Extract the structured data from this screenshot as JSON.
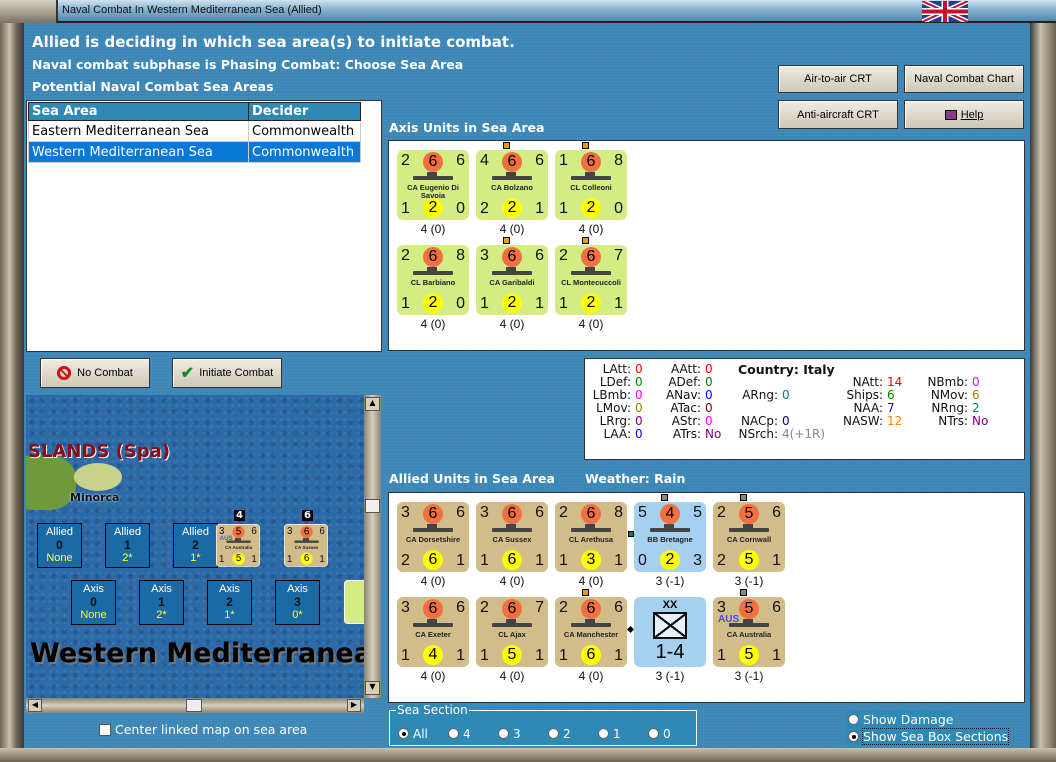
{
  "window": {
    "title": "Naval Combat In Western Mediterranean Sea (Allied)"
  },
  "header": {
    "line1": "Allied is deciding in which sea area(s) to initiate combat.",
    "line2": "Naval combat subphase is Phasing Combat: Choose Sea Area",
    "line3": "Potential Naval Combat Sea Areas"
  },
  "sea_table": {
    "columns": [
      "Sea Area",
      "Decider"
    ],
    "rows": [
      {
        "area": "Eastern Mediterranean Sea",
        "decider": "Commonwealth",
        "selected": false
      },
      {
        "area": "Western Mediterranean Sea",
        "decider": "Commonwealth",
        "selected": true
      }
    ]
  },
  "buttons": {
    "air_to_air": "Air-to-air CRT",
    "naval_chart": "Naval Combat Chart",
    "anti_aircraft": "Anti-aircraft CRT",
    "help": "Help",
    "no_combat": "No Combat",
    "initiate": "Initiate Combat"
  },
  "axis": {
    "title": "Axis Units in Sea Area",
    "units": [
      {
        "name": "CA Eugenio Di Savoia",
        "tl": "2",
        "tc": "6",
        "tr": "6",
        "bl": "1",
        "bc": "2",
        "br": "0",
        "label": "4 (0)",
        "marker": ""
      },
      {
        "name": "CA Bolzano",
        "tl": "4",
        "tc": "6",
        "tr": "6",
        "bl": "2",
        "bc": "2",
        "br": "1",
        "label": "4 (0)",
        "marker": "#e89a10"
      },
      {
        "name": "CL Colleoni",
        "tl": "1",
        "tc": "6",
        "tr": "8",
        "bl": "1",
        "bc": "2",
        "br": "0",
        "label": "4 (0)",
        "marker": "#e89a10"
      },
      {
        "name": "CL Barbiano",
        "tl": "2",
        "tc": "6",
        "tr": "8",
        "bl": "1",
        "bc": "2",
        "br": "0",
        "label": "4 (0)",
        "marker": ""
      },
      {
        "name": "CA Garibaldi",
        "tl": "3",
        "tc": "6",
        "tr": "6",
        "bl": "1",
        "bc": "2",
        "br": "1",
        "label": "4 (0)",
        "marker": "#e89a10"
      },
      {
        "name": "CL Montecuccoli",
        "tl": "2",
        "tc": "6",
        "tr": "7",
        "bl": "1",
        "bc": "2",
        "br": "1",
        "label": "4 (0)",
        "marker": "#e89a10"
      }
    ]
  },
  "stats": {
    "country_label": "Country: Italy",
    "items": [
      {
        "k": "LAtt:",
        "v": "0",
        "c": "#ff0000"
      },
      {
        "k": "LDef:",
        "v": "0",
        "c": "#008000"
      },
      {
        "k": "LBmb:",
        "v": "0",
        "c": "#ff00ff"
      },
      {
        "k": "LMov:",
        "v": "0",
        "c": "#a08000"
      },
      {
        "k": "LRrg:",
        "v": "0",
        "c": "#800080"
      },
      {
        "k": "LAA:",
        "v": "0",
        "c": "#0000ff"
      },
      {
        "k": "AAtt:",
        "v": "0",
        "c": "#ff0000"
      },
      {
        "k": "ADef:",
        "v": "0",
        "c": "#008000"
      },
      {
        "k": "ANav:",
        "v": "0",
        "c": "#0000ff"
      },
      {
        "k": "ATac:",
        "v": "0",
        "c": "#800000"
      },
      {
        "k": "AStr:",
        "v": "0",
        "c": "#ff00ff"
      },
      {
        "k": "ATrs:",
        "v": "No",
        "c": "#800080"
      },
      {
        "k": "ARng:",
        "v": "0",
        "c": "#008080"
      },
      {
        "k": "NACp:",
        "v": "0",
        "c": "#000080"
      },
      {
        "k": "NSrch:",
        "v": "4(+1R)",
        "c": "#888888"
      },
      {
        "k": "NAtt:",
        "v": "14",
        "c": "#ff0000"
      },
      {
        "k": "Ships:",
        "v": "6",
        "c": "#008000"
      },
      {
        "k": "NAA:",
        "v": "7",
        "c": "#0000ff"
      },
      {
        "k": "NASW:",
        "v": "12",
        "c": "#ff8000"
      },
      {
        "k": "NBmb:",
        "v": "0",
        "c": "#ff00ff"
      },
      {
        "k": "NMov:",
        "v": "6",
        "c": "#a08000"
      },
      {
        "k": "NRng:",
        "v": "2",
        "c": "#008080"
      },
      {
        "k": "NTrs:",
        "v": "No",
        "c": "#800080"
      }
    ]
  },
  "allied": {
    "title": "Allied Units in Sea Area",
    "weather": "Weather:  Rain",
    "units": [
      {
        "name": "CA Dorsetshire",
        "tl": "3",
        "tc": "6",
        "tr": "6",
        "bl": "2",
        "bc": "6",
        "br": "1",
        "label": "4 (0)",
        "marker": ""
      },
      {
        "name": "CA Sussex",
        "tl": "3",
        "tc": "6",
        "tr": "6",
        "bl": "1",
        "bc": "6",
        "br": "1",
        "label": "4 (0)",
        "marker": ""
      },
      {
        "name": "CL Arethusa",
        "tl": "2",
        "tc": "6",
        "tr": "8",
        "bl": "1",
        "bc": "3",
        "br": "1",
        "label": "4 (0)",
        "marker": ""
      },
      {
        "name": "BB Bretagne",
        "tl": "5",
        "tc": "4",
        "tr": "5",
        "bl": "0",
        "bc": "2",
        "br": "3",
        "label": "3 (-1)",
        "marker": "#888888",
        "blue": true
      },
      {
        "name": "CA Cornwall",
        "tl": "2",
        "tc": "5",
        "tr": "6",
        "bl": "2",
        "bc": "5",
        "br": "1",
        "label": "3 (-1)",
        "marker": "#888888"
      },
      {
        "name": "CA Exeter",
        "tl": "3",
        "tc": "6",
        "tr": "6",
        "bl": "1",
        "bc": "4",
        "br": "1",
        "label": "4 (0)",
        "marker": ""
      },
      {
        "name": "CL Ajax",
        "tl": "2",
        "tc": "6",
        "tr": "7",
        "bl": "1",
        "bc": "5",
        "br": "1",
        "label": "4 (0)",
        "marker": ""
      },
      {
        "name": "CA Manchester",
        "tl": "2",
        "tc": "6",
        "tr": "6",
        "bl": "1",
        "bc": "6",
        "br": "1",
        "label": "4 (0)",
        "marker": "#e89a10"
      },
      {
        "division": true,
        "size": "XX",
        "strength": "1-4",
        "label": "3 (-1)",
        "marker": ""
      },
      {
        "name": "CA Australia",
        "tl": "3",
        "tc": "5",
        "tr": "6",
        "bl": "1",
        "bc": "5",
        "br": "1",
        "label": "3 (-1)",
        "marker": "#888888",
        "nat": "AUS"
      }
    ]
  },
  "map": {
    "region_label": "SLANDS (Spa)",
    "island": "Minorca",
    "sea_name": "Western Mediterranea",
    "allied_boxes": [
      {
        "t": "Allied",
        "n": "0",
        "v": "None"
      },
      {
        "t": "Allied",
        "n": "1",
        "v": "2*"
      },
      {
        "t": "Allied",
        "n": "2",
        "v": "1*"
      }
    ],
    "axis_boxes": [
      {
        "t": "Axis",
        "n": "0",
        "v": "None"
      },
      {
        "t": "Axis",
        "n": "1",
        "v": "2*"
      },
      {
        "t": "Axis",
        "n": "2",
        "v": "1*"
      },
      {
        "t": "Axis",
        "n": "3",
        "v": "0*"
      }
    ],
    "stack1": {
      "count": "4",
      "name": "CA Australia",
      "nat": "AUS",
      "tl": "3",
      "tc": "5",
      "tr": "6",
      "bl": "1",
      "bc": "5",
      "br": "1"
    },
    "stack2": {
      "count": "6",
      "name": "CA Sussex",
      "tl": "3",
      "tc": "6",
      "tr": "6",
      "bl": "1",
      "bc": "6",
      "br": "1"
    }
  },
  "center_map_label": "Center linked map on sea area",
  "sea_section": {
    "legend": "Sea Section",
    "options": [
      "All",
      "4",
      "3",
      "2",
      "1",
      "0"
    ],
    "selected": "All"
  },
  "display": {
    "show_damage": "Show Damage",
    "show_sections": "Show Sea Box Sections"
  }
}
